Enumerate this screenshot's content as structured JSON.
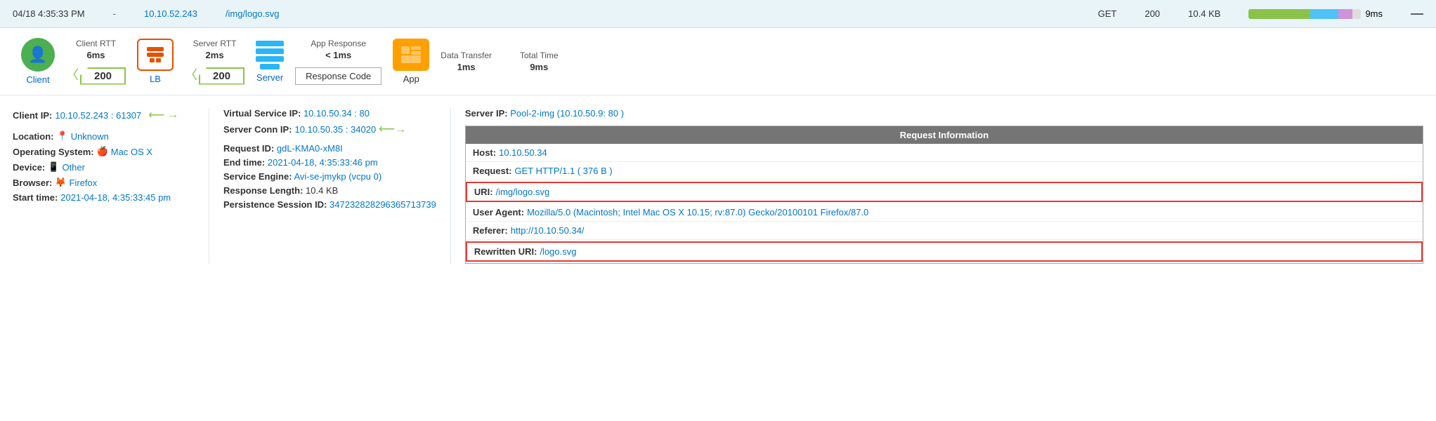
{
  "topbar": {
    "timestamp": "04/18 4:35:33 PM",
    "dash": "-",
    "ip": "10.10.52.243",
    "path": "/img/logo.svg",
    "method": "GET",
    "status": "200",
    "size": "10.4 KB",
    "duration": "9ms",
    "minus": "—"
  },
  "metrics": {
    "client_label": "Client",
    "client_rtt_title": "Client RTT",
    "client_rtt_value": "6ms",
    "lb_label": "LB",
    "server_rtt_title": "Server RTT",
    "server_rtt_value": "2ms",
    "server_label": "Server",
    "app_response_title": "App Response",
    "app_response_value": "< 1ms",
    "app_label": "App",
    "data_transfer_title": "Data Transfer",
    "data_transfer_value": "1ms",
    "total_time_title": "Total Time",
    "total_time_value": "9ms",
    "status_200_client": "200",
    "status_200_server": "200",
    "response_code_label": "Response Code"
  },
  "left": {
    "client_ip_label": "Client IP:",
    "client_ip_value": "10.10.52.243 : 61307",
    "location_label": "Location:",
    "location_icon": "📍",
    "location_value": "Unknown",
    "os_label": "Operating System:",
    "os_icon": "🍎",
    "os_value": "Mac OS X",
    "device_label": "Device:",
    "device_icon": "📱",
    "device_value": "Other",
    "browser_label": "Browser:",
    "browser_icon": "🦊",
    "browser_value": "Firefox",
    "start_time_label": "Start time:",
    "start_time_value": "2021-04-18, 4:35:33:45 pm"
  },
  "middle": {
    "vs_ip_label": "Virtual Service IP:",
    "vs_ip_value": "10.10.50.34 : 80",
    "server_conn_label": "Server Conn IP:",
    "server_conn_value": "10.10.50.35 : 34020",
    "request_id_label": "Request ID:",
    "request_id_value": "gdL-KMA0-xM8I",
    "end_time_label": "End time:",
    "end_time_value": "2021-04-18, 4:35:33:46 pm",
    "service_engine_label": "Service Engine:",
    "service_engine_value": "Avi-se-jmykp (vcpu 0)",
    "response_length_label": "Response Length:",
    "response_length_value": "10.4 KB",
    "persistence_label": "Persistence Session ID:",
    "persistence_value": "347232828296365713739"
  },
  "right": {
    "server_ip_label": "Server IP:",
    "server_ip_value": "Pool-2-img (10.10.50.9: 80 )",
    "request_info_header": "Request Information",
    "host_label": "Host:",
    "host_value": "10.10.50.34",
    "request_label": "Request:",
    "request_value": "GET HTTP/1.1 ( 376 B )",
    "uri_label": "URI:",
    "uri_value": "/img/logo.svg",
    "user_agent_label": "User Agent:",
    "user_agent_value": "Mozilla/5.0 (Macintosh; Intel Mac OS X 10.15; rv:87.0) Gecko/20100101 Firefox/87.0",
    "referer_label": "Referer:",
    "referer_value": "http://10.10.50.34/",
    "rewritten_uri_label": "Rewritten URI:",
    "rewritten_uri_value": "/logo.svg"
  }
}
